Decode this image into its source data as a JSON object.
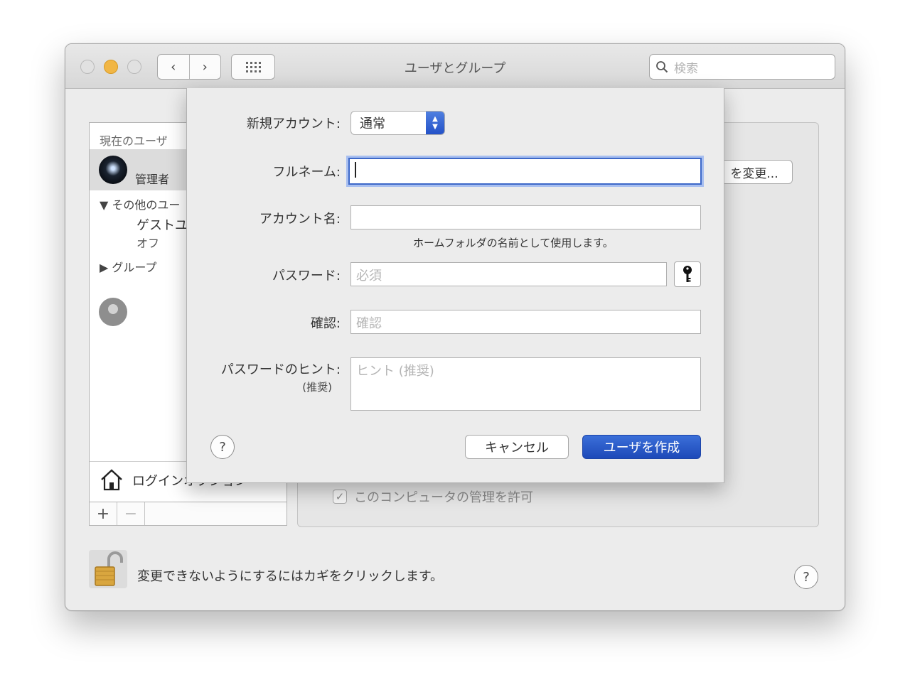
{
  "window": {
    "title": "ユーザとグループ",
    "search_placeholder": "検索"
  },
  "sidebar": {
    "header": "現在のユーザ",
    "current_user_role": "管理者",
    "other_users_label": "その他のユー",
    "guest_name": "ゲストユ",
    "guest_status": "オフ",
    "groups_label": "グループ",
    "login_options_label": "ログインオプション",
    "add_label": "+",
    "remove_label": "−"
  },
  "main": {
    "change_password_button": "を変更...",
    "allow_admin_label": "このコンピュータの管理を許可",
    "lock_text": "変更できないようにするにはカギをクリックします。",
    "help_label": "?"
  },
  "sheet": {
    "new_account_label": "新規アカウント:",
    "account_type_value": "通常",
    "full_name_label": "フルネーム:",
    "full_name_value": "",
    "account_name_label": "アカウント名:",
    "account_name_value": "",
    "account_name_note": "ホームフォルダの名前として使用します。",
    "password_label": "パスワード:",
    "password_placeholder": "必須",
    "verify_label": "確認:",
    "verify_placeholder": "確認",
    "hint_label": "パスワードのヒント:",
    "hint_sublabel": "(推奨)",
    "hint_placeholder": "ヒント (推奨)",
    "help_label": "?",
    "cancel_button": "キャンセル",
    "create_button": "ユーザを作成"
  },
  "icons": [
    "search-icon",
    "key-icon",
    "lock-icon",
    "house-icon",
    "help-icon",
    "chevron-left-icon",
    "chevron-right-icon",
    "grid-icon"
  ],
  "colors": {
    "accent": "#2452c8",
    "window_bg": "#ececec",
    "traffic_yellow": "#f1b645"
  }
}
